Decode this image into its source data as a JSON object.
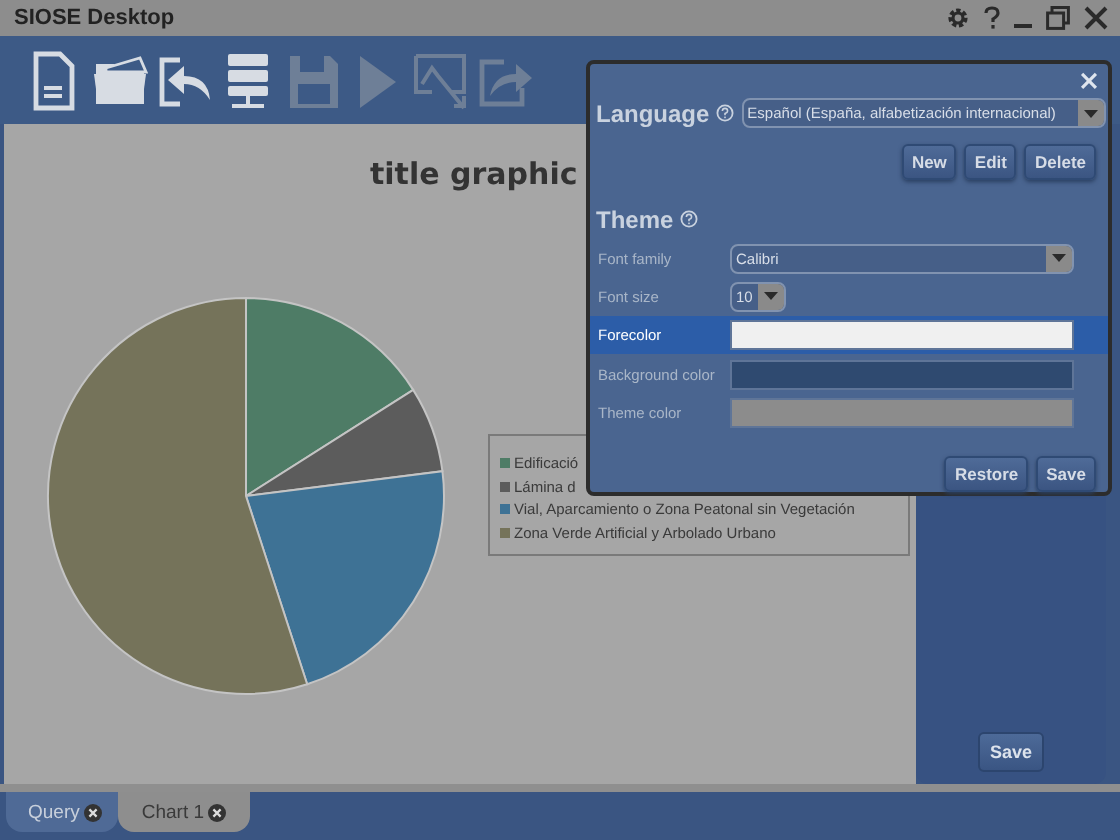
{
  "window": {
    "title": "SIOSE Desktop"
  },
  "toolbar": [
    {
      "disabled": false
    },
    {
      "disabled": false
    },
    {
      "disabled": false
    },
    {
      "disabled": false
    },
    {
      "disabled": true
    },
    {
      "disabled": true
    },
    {
      "disabled": true
    },
    {
      "disabled": true
    }
  ],
  "chart": {
    "title": "title graphic",
    "legend": [
      {
        "label": "Edificació",
        "color": "#4e7c66"
      },
      {
        "label": "Lámina d",
        "color": "#5c5c5c"
      },
      {
        "label": "Vial, Aparcamiento o Zona Peatonal sin Vegetación",
        "color": "#3e7295"
      },
      {
        "label": "Zona Verde Artificial y Arbolado Urbano",
        "color": "#75735a"
      }
    ]
  },
  "side_panel": {
    "button": "Save"
  },
  "dialog": {
    "language_heading": "Language",
    "language_value": "Español (España, alfabetización internacional)",
    "language_buttons": [
      "New",
      "Edit",
      "Delete"
    ],
    "theme_heading": "Theme",
    "rows": [
      {
        "kind": "select",
        "label": "Font family",
        "value": "Calibri",
        "selected": false
      },
      {
        "kind": "select",
        "label": "Font size",
        "value": "10",
        "selected": false
      },
      {
        "kind": "color",
        "label": "Forecolor",
        "color": "#f0f0f0",
        "selected": true
      },
      {
        "kind": "color",
        "label": "Background color",
        "color": "#2f4a70",
        "selected": false
      },
      {
        "kind": "color",
        "label": "Theme color",
        "color": "#8c8c8c",
        "selected": false
      }
    ],
    "buttons": [
      "Restore",
      "Save"
    ]
  },
  "tabs": [
    {
      "label": "Query",
      "selected": false
    },
    {
      "label": "Chart 1",
      "selected": true
    }
  ]
}
